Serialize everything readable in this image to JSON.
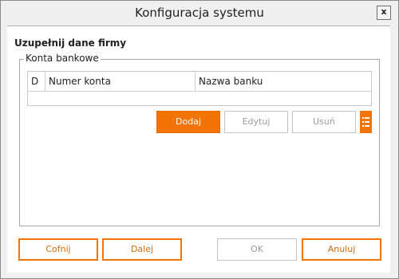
{
  "window": {
    "title": "Konfiguracja systemu",
    "close_label": "x"
  },
  "section": {
    "heading": "Uzupełnij dane firmy"
  },
  "bank_accounts": {
    "group_label": "Konta bankowe",
    "columns": [
      "D",
      "Numer konta",
      "Nazwa banku"
    ],
    "rows": []
  },
  "actions": {
    "add": "Dodaj",
    "edit": "Edytuj",
    "delete": "Usuń",
    "menu_icon": "list-menu-icon"
  },
  "footer": {
    "back": "Cofnij",
    "next": "Dalej",
    "ok": "OK",
    "cancel": "Anuluj"
  },
  "colors": {
    "accent": "#f27405",
    "disabled_text": "#9a9a9a"
  }
}
